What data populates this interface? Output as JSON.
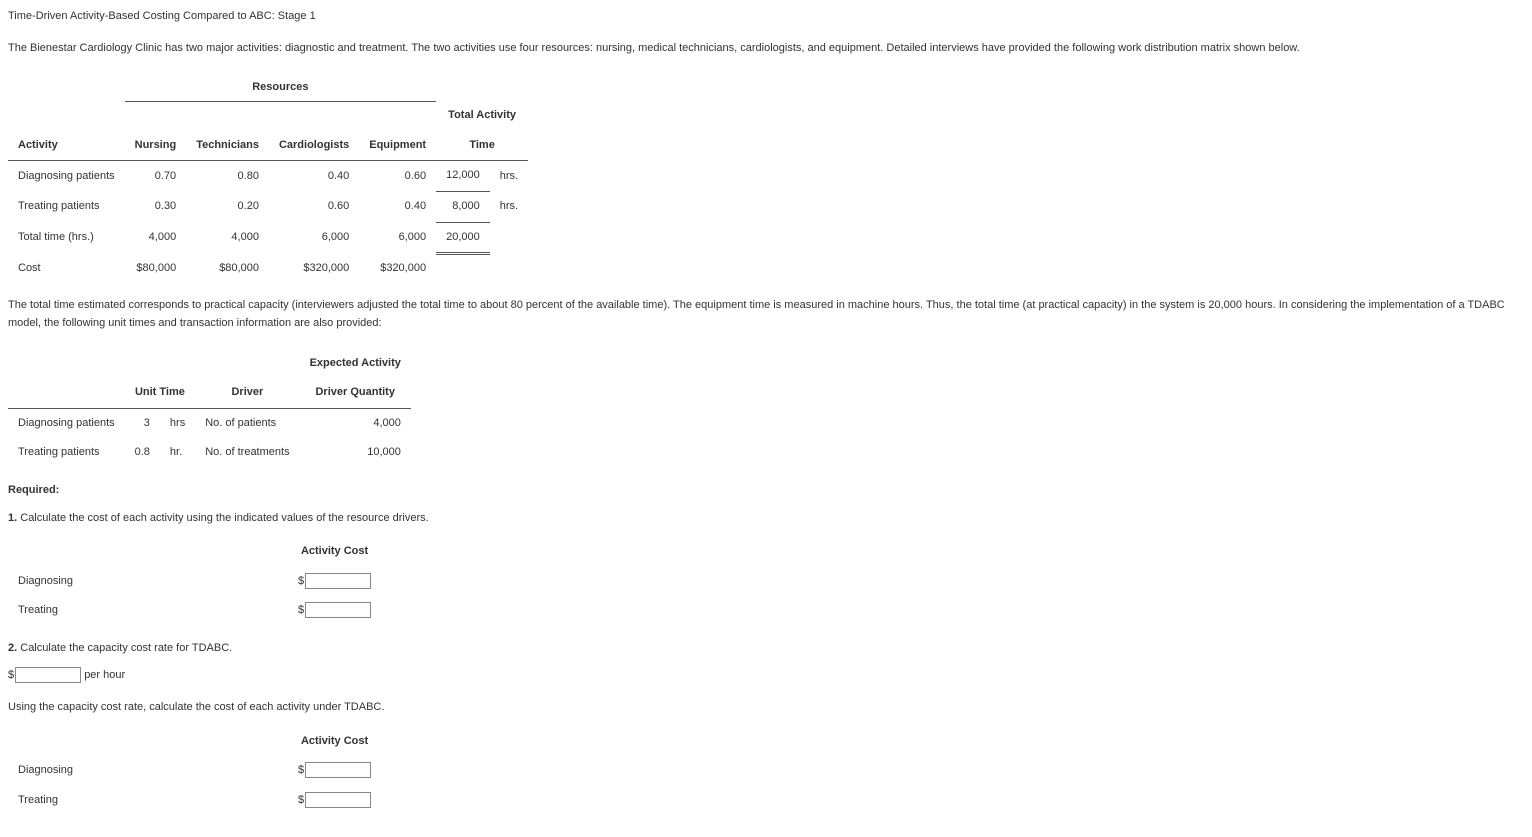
{
  "title": "Time-Driven Activity-Based Costing Compared to ABC: Stage 1",
  "para1": "The Bienestar Cardiology Clinic has two major activities: diagnostic and treatment. The two activities use four resources: nursing, medical technicians, cardiologists, and equipment. Detailed interviews have provided the following work distribution matrix shown below.",
  "t1": {
    "resourcesLabel": "Resources",
    "activityLabel": "Activity",
    "colNursing": "Nursing",
    "colTechnicians": "Technicians",
    "colCardiologists": "Cardiologists",
    "colEquipment": "Equipment",
    "colTotalActivity": "Total Activity",
    "colTime": "Time",
    "rowDiag": "Diagnosing patients",
    "rowTreat": "Treating patients",
    "rowTotalTime": "Total time (hrs.)",
    "rowCost": "Cost",
    "d": {
      "nursing": "0.70",
      "tech": "0.80",
      "card": "0.40",
      "equip": "0.60",
      "tot": "12,000",
      "unit": "hrs."
    },
    "t": {
      "nursing": "0.30",
      "tech": "0.20",
      "card": "0.60",
      "equip": "0.40",
      "tot": "8,000",
      "unit": "hrs."
    },
    "totrow": {
      "nursing": "4,000",
      "tech": "4,000",
      "card": "6,000",
      "equip": "6,000",
      "tot": "20,000"
    },
    "costrow": {
      "nursing": "$80,000",
      "tech": "$80,000",
      "card": "$320,000",
      "equip": "$320,000"
    }
  },
  "para2": "The total time estimated corresponds to practical capacity (interviewers adjusted the total time to about 80 percent of the available time). The equipment time is measured in machine hours. Thus, the total time (at practical capacity) in the system is 20,000 hours. In considering the implementation of a TDABC model, the following unit times and transaction information are also provided:",
  "t2": {
    "colUnitTime": "Unit Time",
    "colDriver": "Driver",
    "colExpected1": "Expected Activity",
    "colExpected2": "Driver Quantity",
    "rowDiag": "Diagnosing patients",
    "rowTreat": "Treating patients",
    "d": {
      "ut": "3",
      "utUnit": "hrs",
      "driver": "No. of patients",
      "qty": "4,000"
    },
    "t": {
      "ut": "0.8",
      "utUnit": "hr.",
      "driver": "No. of treatments",
      "qty": "10,000"
    }
  },
  "requiredLabel": "Required:",
  "q1": {
    "num": "1.",
    "text": "Calculate the cost of each activity using the indicated values of the resource drivers."
  },
  "actCostLabel": "Activity Cost",
  "diagLabel": "Diagnosing",
  "treatLabel": "Treating",
  "q2": {
    "num": "2.",
    "text": "Calculate the capacity cost rate for TDABC."
  },
  "perHour": "per hour",
  "q2b": "Using the capacity cost rate, calculate the cost of each activity under TDABC.",
  "dollar": "$"
}
